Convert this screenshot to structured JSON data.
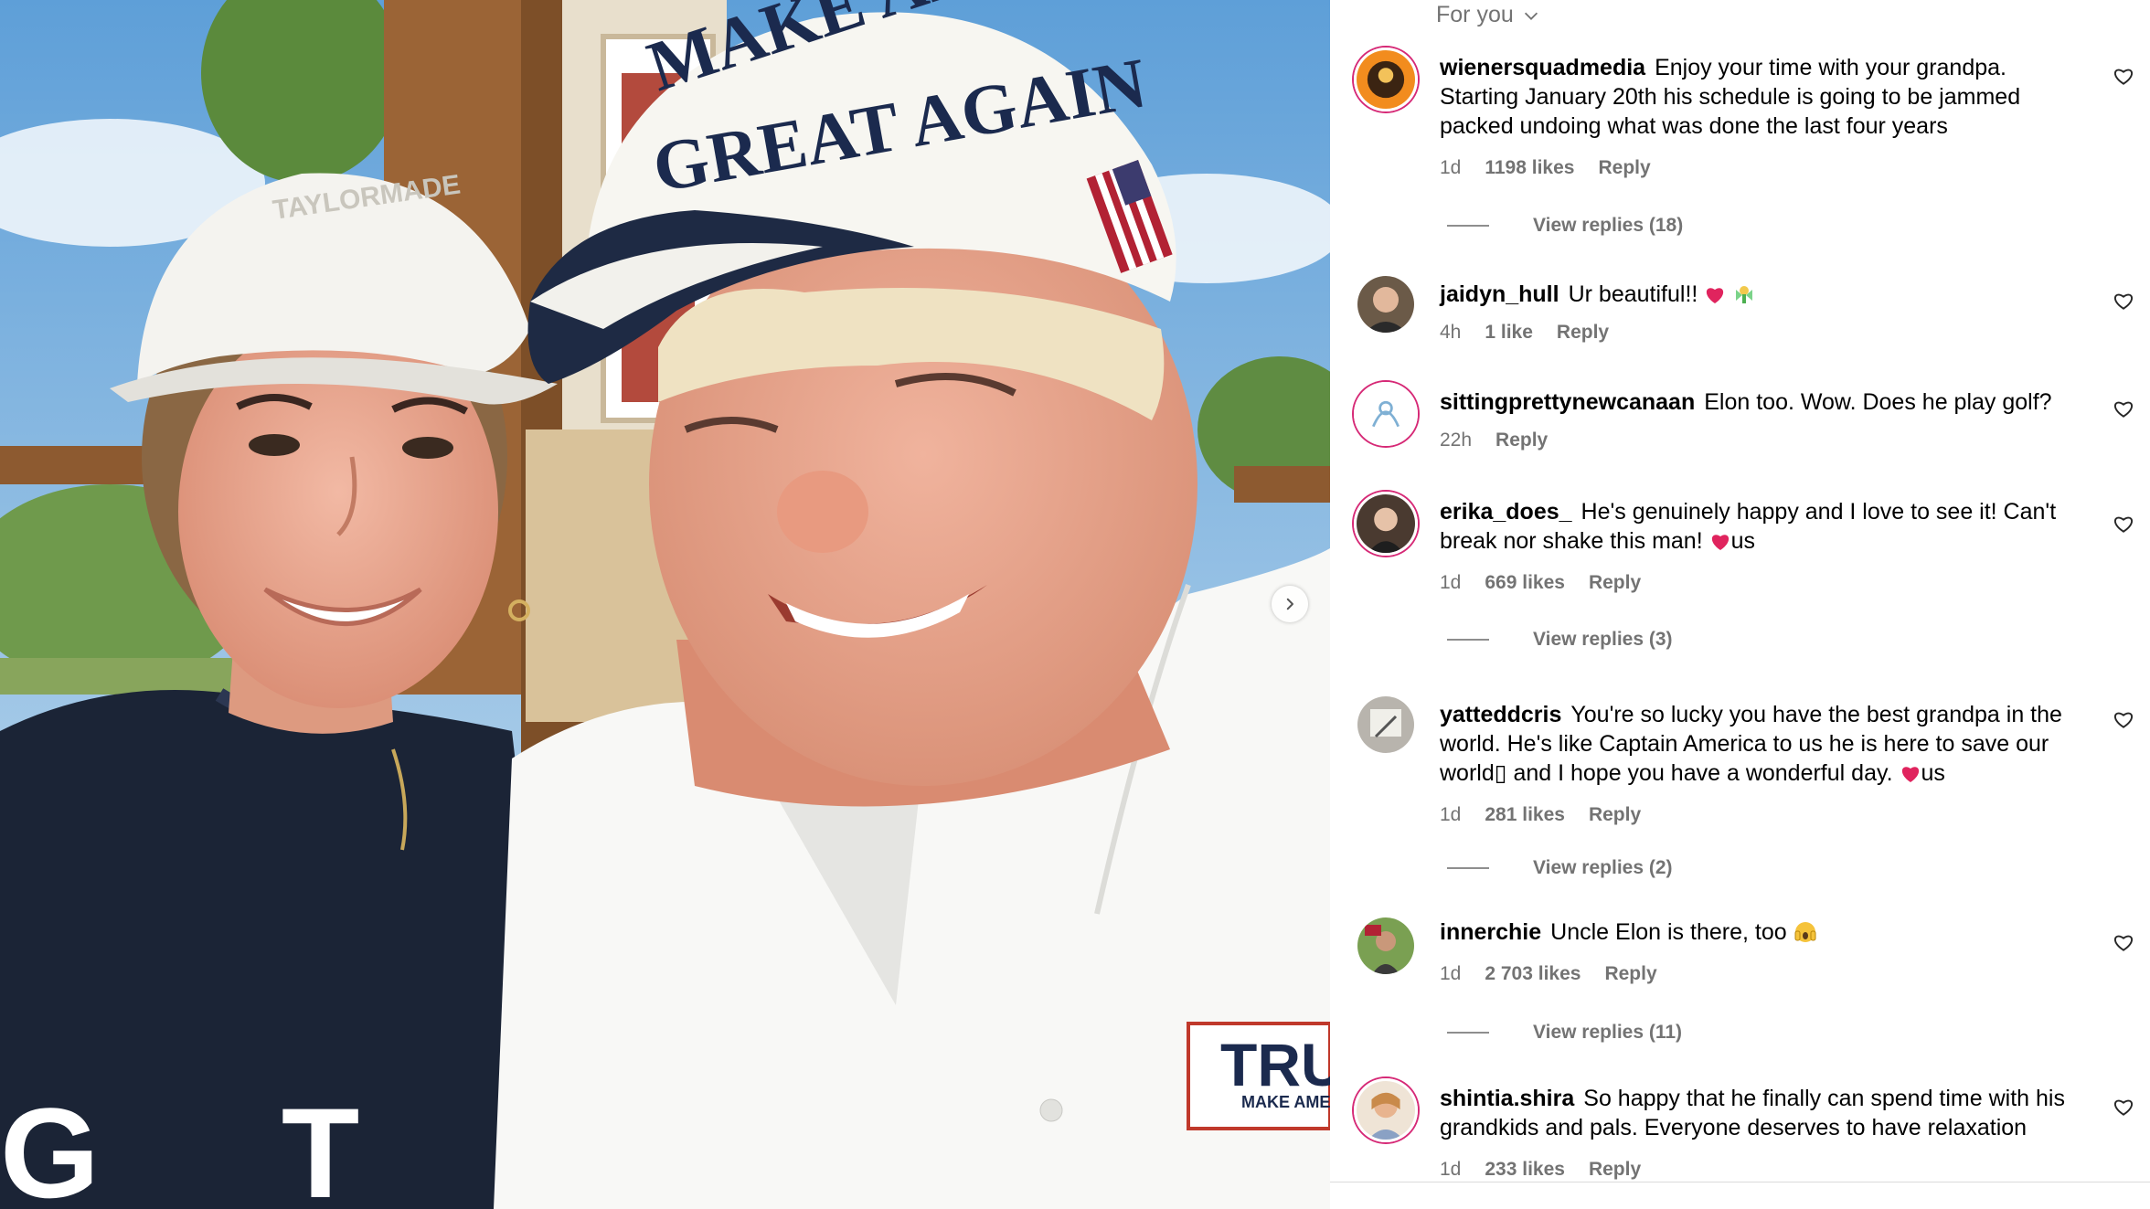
{
  "post": {
    "photo_alt": "",
    "hat_text_line1": "MAKE AMERICA",
    "hat_text_line2": "GREAT AGAIN",
    "shirt_text_line1": "TRU",
    "shirt_text_line2": "MAKE AMER"
  },
  "comments_panel": {
    "sort_label": "For you",
    "comments": [
      {
        "username": "wienersquadmedia",
        "text": "Enjoy your time with your grandpa. Starting January 20th his schedule is going to be jammed packed undoing what was done the last four years",
        "age": "1d",
        "likes": "1198 likes",
        "reply_label": "Reply",
        "view_replies": "View replies (18)"
      },
      {
        "username": "jaidyn_hull",
        "text": "Ur beautiful!!",
        "age": "4h",
        "likes": "1 like",
        "reply_label": "Reply"
      },
      {
        "username": "sittingprettynewcanaan",
        "text": "Elon too. Wow. Does he play golf?",
        "age": "22h",
        "reply_label": "Reply"
      },
      {
        "username": "erika_does_",
        "text": "He's genuinely happy and I love to see it! Can't break nor shake this man!",
        "text_suffix": "us",
        "age": "1d",
        "likes": "669 likes",
        "reply_label": "Reply",
        "view_replies": "View replies (3)"
      },
      {
        "username": "yatteddcris",
        "text": "You're so lucky you have the best grandpa in the world. He's like Captain America to us he is here to save our world▯ and I hope you have a wonderful day.",
        "text_suffix": "us",
        "age": "1d",
        "likes": "281 likes",
        "reply_label": "Reply",
        "view_replies": "View replies (2)"
      },
      {
        "username": "innerchie",
        "text": "Uncle Elon is there, too",
        "age": "1d",
        "likes": "2 703 likes",
        "reply_label": "Reply",
        "view_replies": "View replies (11)"
      },
      {
        "username": "shintia.shira",
        "text": "So happy that he finally can spend time with his grandkids and pals. Everyone deserves to have relaxation",
        "age": "1d",
        "likes": "233 likes",
        "reply_label": "Reply"
      }
    ]
  },
  "colors": {
    "meta_gray": "#737373",
    "heart_red": "#e0245e",
    "avatar_ring": "#d62976",
    "navy": "#1b2a4e"
  }
}
